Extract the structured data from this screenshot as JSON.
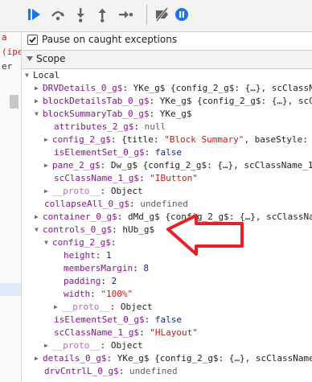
{
  "pause_on_exceptions": {
    "label": "Pause on caught exceptions",
    "checked": true
  },
  "scope": {
    "label": "Scope"
  },
  "left_panel": {
    "items": [
      {
        "text": "a"
      },
      {
        "text": "(ipe"
      },
      {
        "text": "er"
      }
    ]
  },
  "tree": {
    "local_label": "Local",
    "rows": [
      {
        "key": "DRVDetails_0_g$",
        "sep": ": ",
        "value": "YKe_g$ {config_2_g$: {…}, scClassName",
        "vclass": "plain"
      },
      {
        "key": "blockDetailsTab_0_g$",
        "sep": ": ",
        "value": "YKe_g$ {config_2_g$: {…}, scCl",
        "vclass": "plain"
      },
      {
        "key": "blockSummaryTab_0_g$",
        "sep": ": ",
        "value": "YKe_g$",
        "vclass": "plain"
      },
      {
        "key": "attributes_2_g$",
        "sep": ": ",
        "value": "null",
        "vclass": "grey"
      },
      {
        "key": "config_2_g$",
        "sep": ": ",
        "pre": "{title: ",
        "value": "\"Block Summary\"",
        "post": ", baseStyle:",
        "vclass": "str"
      },
      {
        "key": "isElementSet_0_g$",
        "sep": ": ",
        "value": "false",
        "vclass": "kw"
      },
      {
        "key": "pane_2_g$",
        "sep": ": ",
        "value": "Dw_g$ {config_2_g$: {…}, scClassName_1",
        "vclass": "plain"
      },
      {
        "key": "scClassName_1_g$",
        "sep": ": ",
        "value": "\"IButton\"",
        "vclass": "str"
      },
      {
        "key": "__proto__",
        "sep": ": ",
        "value": "Object",
        "vclass": "plain"
      },
      {
        "key": "collapseAll_0_g$",
        "sep": ": ",
        "value": "undefined",
        "vclass": "grey"
      },
      {
        "key": "container_0_g$",
        "sep": ": ",
        "value": "dMd_g$ {config_2_g$: {…}, scClassNa",
        "vclass": "plain"
      },
      {
        "key": "controls_0_g$",
        "sep": ": ",
        "value": "hUb_g$",
        "vclass": "plain"
      },
      {
        "key": "config_2_g$",
        "sep": ":",
        "value": "",
        "vclass": "plain"
      },
      {
        "key": "height",
        "sep": ": ",
        "value": "1",
        "vclass": "num"
      },
      {
        "key": "membersMargin",
        "sep": ": ",
        "value": "8",
        "vclass": "num"
      },
      {
        "key": "padding",
        "sep": ": ",
        "value": "2",
        "vclass": "num"
      },
      {
        "key": "width",
        "sep": ": ",
        "value": "\"100%\"",
        "vclass": "str"
      },
      {
        "key": "__proto__",
        "sep": ": ",
        "value": "Object",
        "vclass": "plain"
      },
      {
        "key": "isElementSet_0_g$",
        "sep": ": ",
        "value": "false",
        "vclass": "kw"
      },
      {
        "key": "scClassName_1_g$",
        "sep": ": ",
        "value": "\"HLayout\"",
        "vclass": "str"
      },
      {
        "key": "__proto__",
        "sep": ": ",
        "value": "Object",
        "vclass": "plain"
      },
      {
        "key": "details_0_g$",
        "sep": ": ",
        "value": "YKe_g$ {config_2_g$: {…}, scClassName",
        "vclass": "plain"
      },
      {
        "key": "drvCntrlL_0_g$",
        "sep": ": ",
        "value": "undefined",
        "vclass": "grey"
      }
    ]
  },
  "annotation": {
    "arrow_color": "#e8202a"
  }
}
